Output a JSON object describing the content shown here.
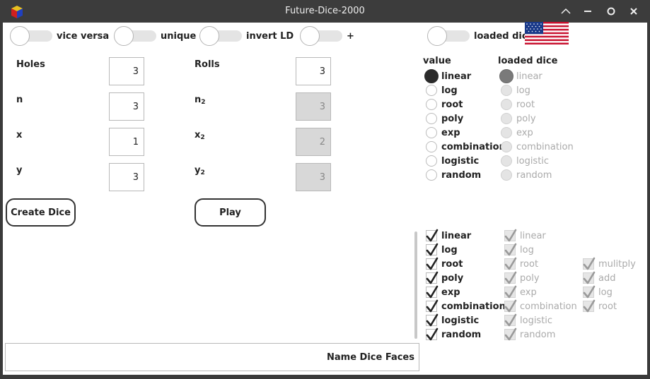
{
  "window": {
    "title": "Future-Dice-2000"
  },
  "toggles": [
    {
      "label": "vice versa"
    },
    {
      "label": "unique"
    },
    {
      "label": "invert LD"
    },
    {
      "label": "+"
    },
    {
      "label": "loaded dice"
    }
  ],
  "fields": {
    "holes": {
      "label": "Holes",
      "value": "3"
    },
    "n": {
      "label": "n",
      "value": "3"
    },
    "x": {
      "label": "x",
      "value": "1"
    },
    "y": {
      "label": "y",
      "value": "3"
    },
    "rolls": {
      "label": "Rolls",
      "value": "3"
    },
    "n2": {
      "label": "n",
      "sub": "2",
      "value": "3"
    },
    "x2": {
      "label": "x",
      "sub": "2",
      "value": "2"
    },
    "y2": {
      "label": "y",
      "sub": "2",
      "value": "3"
    }
  },
  "buttons": {
    "create": "Create Dice",
    "play": "Play"
  },
  "radio_groups": {
    "value_title": "value",
    "loaded_title": "loaded dice",
    "options": [
      "linear",
      "log",
      "root",
      "poly",
      "exp",
      "combination",
      "logistic",
      "random"
    ],
    "value_selected": "linear",
    "loaded_selected": "linear"
  },
  "checks": {
    "value": [
      "linear",
      "log",
      "root",
      "poly",
      "exp",
      "combination",
      "logistic",
      "random"
    ],
    "loaded": [
      "linear",
      "log",
      "root",
      "poly",
      "exp",
      "combination",
      "logistic",
      "random"
    ],
    "ops": [
      "mulitply",
      "add",
      "log",
      "root"
    ]
  },
  "name_faces": "Name Dice Faces",
  "colors": {
    "titlebar": "#3c3c3c",
    "selected_radio": "#2a2a2a"
  }
}
